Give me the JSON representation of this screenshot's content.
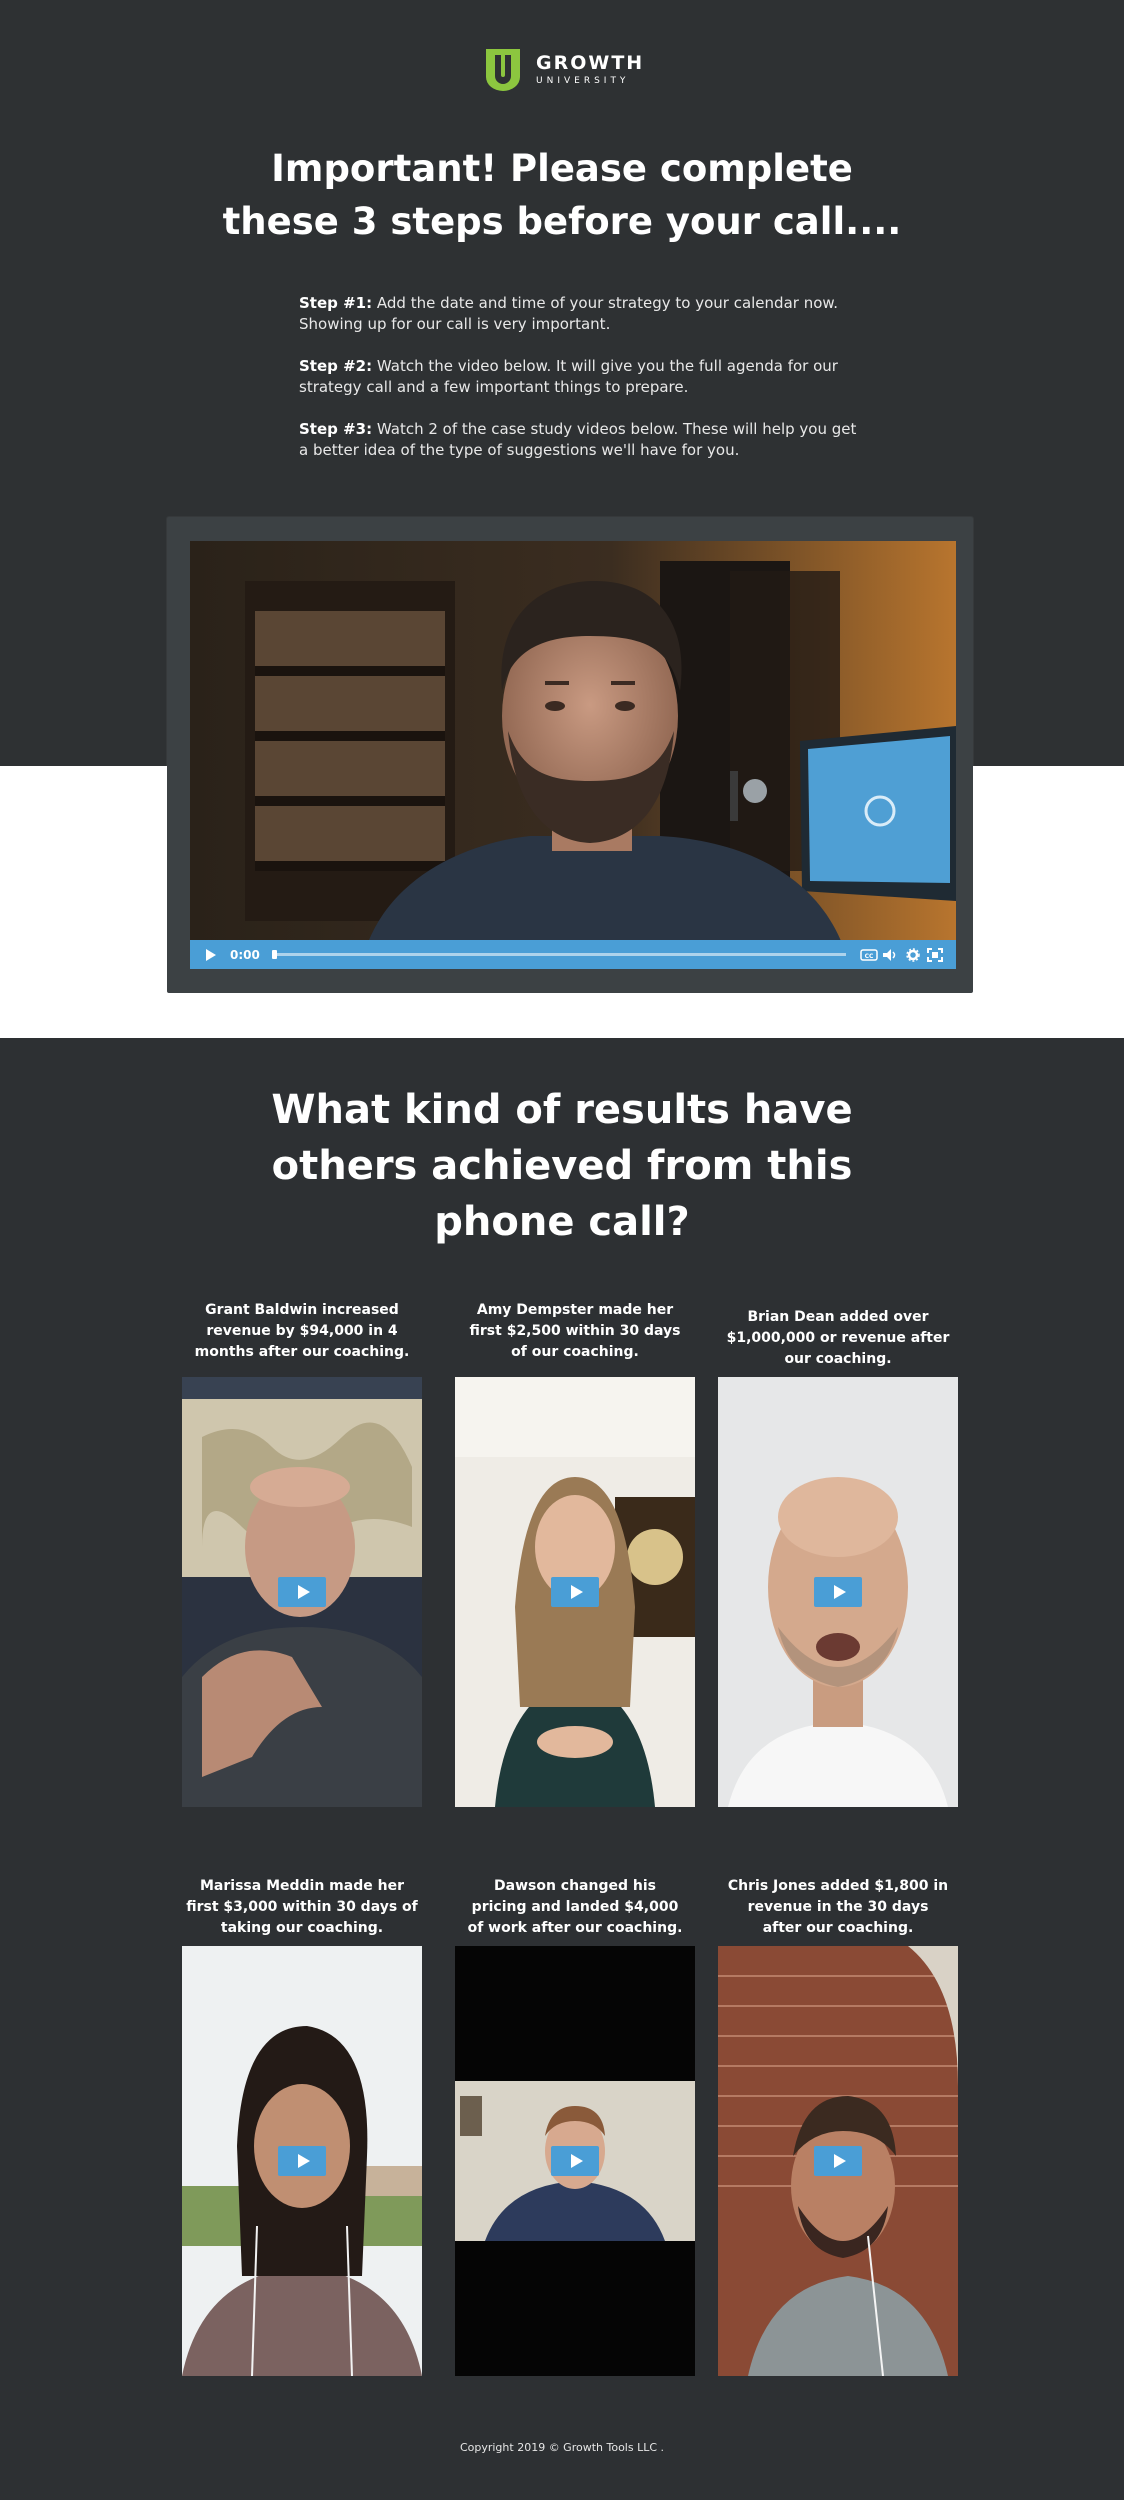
{
  "brand": {
    "name": "GROWTH",
    "sub": "UNIVERSITY",
    "accent": "#8cc63f"
  },
  "hero": {
    "headline_line1": "Important! Please complete",
    "headline_line2": "these 3 steps before your call...."
  },
  "steps": [
    {
      "label": "Step #1:",
      "text": " Add the date and time of your strategy to your calendar now. Showing up for our call is very important."
    },
    {
      "label": "Step #2:",
      "text": " Watch the video below. It will give you the full agenda for our strategy call and a few important things to prepare."
    },
    {
      "label": "Step #3:",
      "text": " Watch 2 of the case study videos below. These will help you get a better idea of the type of suggestions we'll have for you."
    }
  ],
  "main_video": {
    "time": "0:00",
    "progress": 0,
    "controls": [
      "play-icon",
      "captions-icon",
      "volume-icon",
      "settings-icon",
      "fullscreen-icon"
    ]
  },
  "results": {
    "headline_line1": "What kind of results have",
    "headline_line2": "others achieved from this",
    "headline_line3": "phone call?",
    "cards": [
      {
        "line1": "Grant Baldwin increased",
        "line2": "revenue by $94,000 in 4",
        "line3": "months after our coaching."
      },
      {
        "line1": "Amy Dempster made her",
        "line2": "first $2,500 within 30 days",
        "line3": "of our coaching."
      },
      {
        "line1": "Brian Dean added over",
        "line2": "$1,000,000 or revenue after",
        "line3": "our coaching."
      },
      {
        "line1": "Marissa Meddin made her",
        "line2": "first $3,000 within 30 days of",
        "line3": "taking our coaching."
      },
      {
        "line1": "Dawson changed his",
        "line2": "pricing and landed $4,000",
        "line3": "of work after our coaching."
      },
      {
        "line1": "Chris Jones added $1,800 in",
        "line2": "revenue in the 30 days",
        "line3": "after our coaching."
      }
    ]
  },
  "footer": {
    "text": "Copyright 2019 © Growth Tools LLC ."
  },
  "colors": {
    "dark_bg": "#2e3133",
    "player_blue": "#4a9ed6",
    "white": "#ffffff"
  }
}
